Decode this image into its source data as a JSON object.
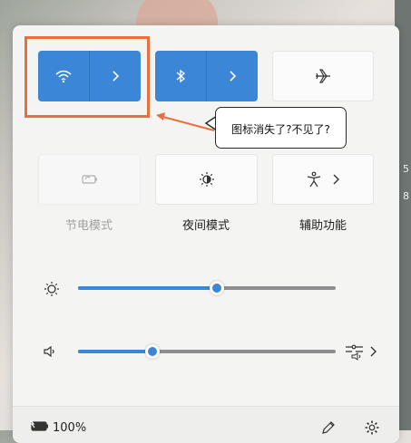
{
  "quick_settings": {
    "tiles": [
      {
        "id": "wifi",
        "label": "",
        "icon": "wifi-icon",
        "state": "on",
        "expand": "chevron-right-icon"
      },
      {
        "id": "bluetooth",
        "label": "",
        "icon": "bluetooth-icon",
        "state": "on",
        "expand": "chevron-right-icon"
      },
      {
        "id": "airplane",
        "label": "",
        "icon": "airplane-icon",
        "state": "off"
      },
      {
        "id": "battery-saver",
        "label": "节电模式",
        "icon": "battery-saver-icon",
        "state": "disabled"
      },
      {
        "id": "night-light",
        "label": "夜间模式",
        "icon": "night-light-icon",
        "state": "off"
      },
      {
        "id": "accessibility",
        "label": "辅助功能",
        "icon": "accessibility-icon",
        "state": "off",
        "expand": "chevron-right-icon"
      }
    ],
    "brightness": {
      "icon": "brightness-icon",
      "value": 0.54
    },
    "volume": {
      "icon": "speaker-icon",
      "value": 0.29,
      "output_icon": "audio-output-icon"
    },
    "footer": {
      "battery_icon": "battery-charging-icon",
      "battery_percent": "100%",
      "edit_icon": "pencil-icon",
      "settings_icon": "gear-icon"
    }
  },
  "annotation": {
    "callout_text": "图标消失了?不见了?",
    "highlight_color": "#e8703f"
  },
  "colors": {
    "accent": "#3b86d6",
    "panel": "#f4f4f3",
    "annotation": "#e8703f"
  }
}
